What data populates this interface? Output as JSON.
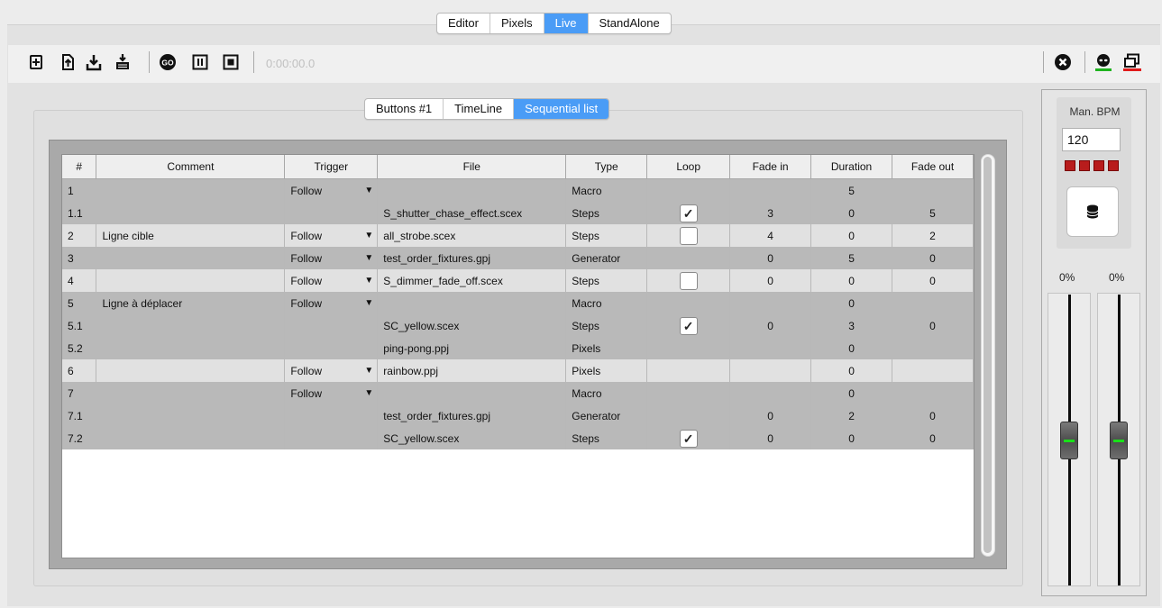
{
  "top_tabs": [
    {
      "label": "Editor",
      "active": false
    },
    {
      "label": "Pixels",
      "active": false
    },
    {
      "label": "Live",
      "active": true
    },
    {
      "label": "StandAlone",
      "active": false
    }
  ],
  "toolbar": {
    "time": "0:00:00.0",
    "icons": [
      "new-icon",
      "open-icon",
      "download-icon",
      "save-icon",
      "go-icon",
      "pause-icon",
      "stop-icon",
      "close-icon",
      "alien-icon",
      "window-icon"
    ]
  },
  "sub_tabs": [
    {
      "label": "Buttons #1",
      "active": false
    },
    {
      "label": "TimeLine",
      "active": false
    },
    {
      "label": "Sequential list",
      "active": true
    }
  ],
  "table": {
    "columns": [
      "#",
      "Comment",
      "Trigger",
      "File",
      "Type",
      "Loop",
      "Fade in",
      "Duration",
      "Fade out"
    ],
    "rows": [
      {
        "num": "1",
        "comment": "",
        "trigger": "Follow",
        "file": "",
        "type": "Macro",
        "loop": null,
        "fade_in": "",
        "duration": "5",
        "fade_out": "",
        "shade": "dark"
      },
      {
        "num": "1.1",
        "comment": "",
        "trigger": "",
        "file": "S_shutter_chase_effect.scex",
        "type": "Steps",
        "loop": true,
        "fade_in": "3",
        "duration": "0",
        "fade_out": "5",
        "shade": "dark"
      },
      {
        "num": "2",
        "comment": "Ligne cible",
        "trigger": "Follow",
        "file": "all_strobe.scex",
        "type": "Steps",
        "loop": false,
        "fade_in": "4",
        "duration": "0",
        "fade_out": "2",
        "shade": "light"
      },
      {
        "num": "3",
        "comment": "",
        "trigger": "Follow",
        "file": "test_order_fixtures.gpj",
        "type": "Generator",
        "loop": null,
        "fade_in": "0",
        "duration": "5",
        "fade_out": "0",
        "shade": "dark"
      },
      {
        "num": "4",
        "comment": "",
        "trigger": "Follow",
        "file": "S_dimmer_fade_off.scex",
        "type": "Steps",
        "loop": false,
        "fade_in": "0",
        "duration": "0",
        "fade_out": "0",
        "shade": "light"
      },
      {
        "num": "5",
        "comment": "Ligne à déplacer",
        "trigger": "Follow",
        "file": "",
        "type": "Macro",
        "loop": null,
        "fade_in": "",
        "duration": "0",
        "fade_out": "",
        "shade": "dark"
      },
      {
        "num": "5.1",
        "comment": "",
        "trigger": "",
        "file": "SC_yellow.scex",
        "type": "Steps",
        "loop": true,
        "fade_in": "0",
        "duration": "3",
        "fade_out": "0",
        "shade": "dark"
      },
      {
        "num": "5.2",
        "comment": "",
        "trigger": "",
        "file": "ping-pong.ppj",
        "type": "Pixels",
        "loop": null,
        "fade_in": "",
        "duration": "0",
        "fade_out": "",
        "shade": "dark"
      },
      {
        "num": "6",
        "comment": "",
        "trigger": "Follow",
        "file": "rainbow.ppj",
        "type": "Pixels",
        "loop": null,
        "fade_in": "",
        "duration": "0",
        "fade_out": "",
        "shade": "light"
      },
      {
        "num": "7",
        "comment": "",
        "trigger": "Follow",
        "file": "",
        "type": "Macro",
        "loop": null,
        "fade_in": "",
        "duration": "0",
        "fade_out": "",
        "shade": "dark"
      },
      {
        "num": "7.1",
        "comment": "",
        "trigger": "",
        "file": "test_order_fixtures.gpj",
        "type": "Generator",
        "loop": null,
        "fade_in": "0",
        "duration": "2",
        "fade_out": "0",
        "shade": "dark"
      },
      {
        "num": "7.2",
        "comment": "",
        "trigger": "",
        "file": "SC_yellow.scex",
        "type": "Steps",
        "loop": true,
        "fade_in": "0",
        "duration": "0",
        "fade_out": "0",
        "shade": "dark"
      }
    ]
  },
  "bpm": {
    "label": "Man. BPM",
    "value": "120",
    "leds": 4,
    "icon": "database-icon"
  },
  "faders": [
    {
      "label": "0%",
      "level": 0.5
    },
    {
      "label": "0%",
      "level": 0.5
    }
  ],
  "colors": {
    "accent": "#4a9cf6",
    "led_red": "#b81c1c",
    "fader_green": "#19e019",
    "icon_green": "#1fb31f",
    "icon_red": "#e01b1b"
  }
}
